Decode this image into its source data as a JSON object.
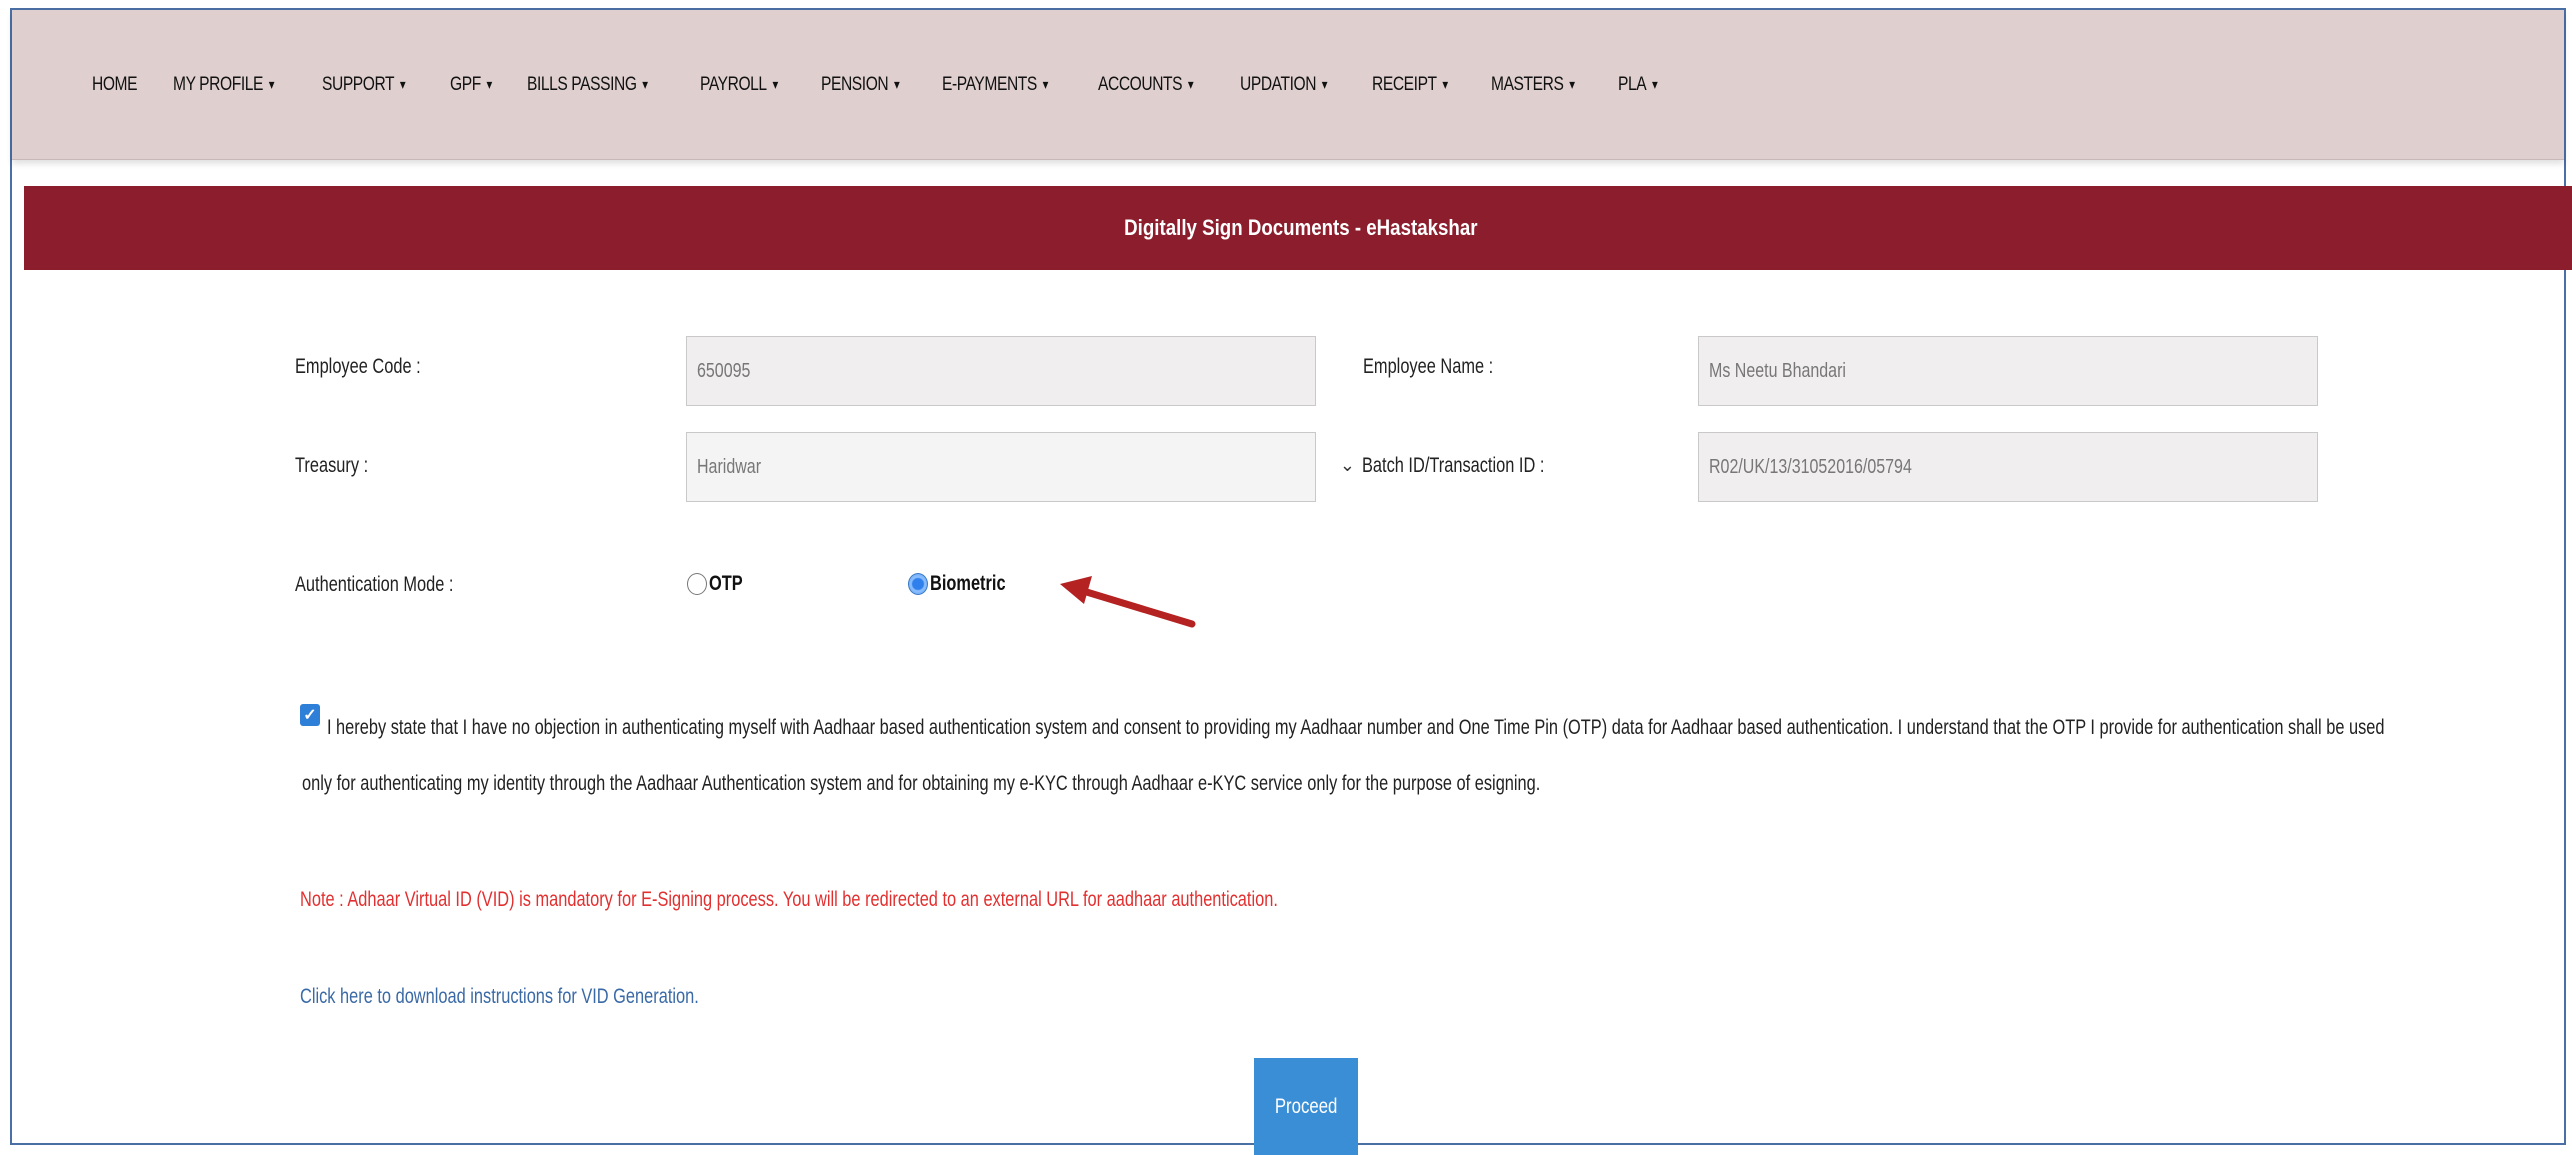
{
  "nav": {
    "items": [
      {
        "label": "HOME",
        "dropdown": false
      },
      {
        "label": "MY PROFILE",
        "dropdown": true
      },
      {
        "label": "SUPPORT",
        "dropdown": true
      },
      {
        "label": "GPF",
        "dropdown": true
      },
      {
        "label": "BILLS PASSING",
        "dropdown": true
      },
      {
        "label": "PAYROLL",
        "dropdown": true
      },
      {
        "label": "PENSION",
        "dropdown": true
      },
      {
        "label": "E-PAYMENTS",
        "dropdown": true
      },
      {
        "label": "ACCOUNTS",
        "dropdown": true
      },
      {
        "label": "UPDATION",
        "dropdown": true
      },
      {
        "label": "RECEIPT",
        "dropdown": true
      },
      {
        "label": "MASTERS",
        "dropdown": true
      },
      {
        "label": "PLA",
        "dropdown": true
      }
    ],
    "caret": "▾"
  },
  "header": {
    "title": "Digitally Sign Documents - eHastakshar"
  },
  "form": {
    "employee_code": {
      "label": "Employee Code :",
      "value": "650095"
    },
    "employee_name": {
      "label": "Employee Name :",
      "value": "Ms Neetu  Bhandari"
    },
    "treasury": {
      "label": "Treasury :",
      "value": "Haridwar"
    },
    "batch_id": {
      "label": "Batch ID/Transaction ID :",
      "value": "R02/UK/13/31052016/05794"
    },
    "auth_mode": {
      "label": "Authentication Mode :",
      "options": [
        {
          "label": "OTP",
          "selected": false
        },
        {
          "label": "Biometric",
          "selected": true
        }
      ]
    },
    "consent": {
      "checked": true,
      "text": "I hereby state that I have no objection in authenticating myself with Aadhaar based authentication system and consent to providing my Aadhaar number and One Time Pin (OTP) data for Aadhaar based authentication. I understand that the OTP I provide for authentication shall be used only for authenticating my identity through the Aadhaar Authentication system and for obtaining my e-KYC through Aadhaar e-KYC service only for the purpose of esigning."
    },
    "note": "Note : Adhaar Virtual ID (VID) is mandatory for E-Signing process. You will be redirected to an external URL for aadhaar authentication.",
    "vid_link": "Click here to download instructions for VID Generation.",
    "proceed_label": "Proceed"
  },
  "colors": {
    "nav_bg": "#dfcfcf",
    "header_bg": "#8b1d2c",
    "note": "#e23030",
    "link": "#3a6aa6",
    "button": "#3a8ed6",
    "arrow": "#b42222"
  }
}
